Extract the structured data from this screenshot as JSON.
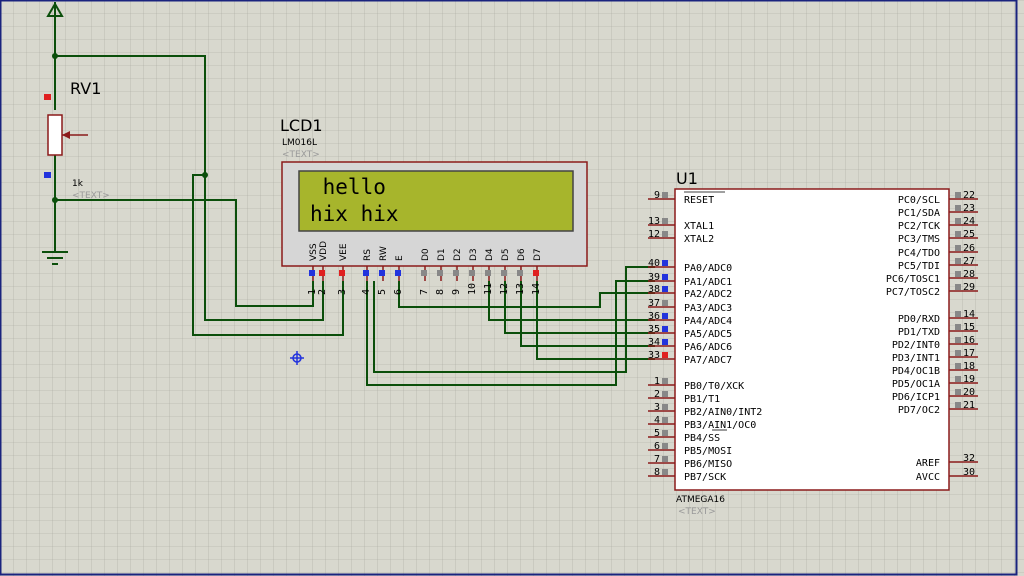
{
  "rv1": {
    "ref": "RV1",
    "value": "1k",
    "text": "<TEXT>"
  },
  "lcd": {
    "ref": "LCD1",
    "part": "LM016L",
    "text": "<TEXT>",
    "line1": " hello",
    "line2": "hix hix",
    "screen_color": "#a7b52c",
    "pins": [
      {
        "num": "1",
        "name": "VSS"
      },
      {
        "num": "2",
        "name": "VDD"
      },
      {
        "num": "3",
        "name": "VEE"
      },
      {
        "num": "4",
        "name": "RS"
      },
      {
        "num": "5",
        "name": "RW"
      },
      {
        "num": "6",
        "name": "E"
      },
      {
        "num": "7",
        "name": "D0"
      },
      {
        "num": "8",
        "name": "D1"
      },
      {
        "num": "9",
        "name": "D2"
      },
      {
        "num": "10",
        "name": "D3"
      },
      {
        "num": "11",
        "name": "D4"
      },
      {
        "num": "12",
        "name": "D5"
      },
      {
        "num": "13",
        "name": "D6"
      },
      {
        "num": "14",
        "name": "D7"
      }
    ]
  },
  "mcu": {
    "ref": "U1",
    "part": "ATMEGA16",
    "text": "<TEXT>",
    "left_pins": [
      {
        "num": "9",
        "name": "RESET"
      },
      {
        "num": "13",
        "name": "XTAL1"
      },
      {
        "num": "12",
        "name": "XTAL2"
      },
      {
        "num": "40",
        "name": "PA0/ADC0"
      },
      {
        "num": "39",
        "name": "PA1/ADC1"
      },
      {
        "num": "38",
        "name": "PA2/ADC2"
      },
      {
        "num": "37",
        "name": "PA3/ADC3"
      },
      {
        "num": "36",
        "name": "PA4/ADC4"
      },
      {
        "num": "35",
        "name": "PA5/ADC5"
      },
      {
        "num": "34",
        "name": "PA6/ADC6"
      },
      {
        "num": "33",
        "name": "PA7/ADC7"
      },
      {
        "num": "1",
        "name": "PB0/T0/XCK"
      },
      {
        "num": "2",
        "name": "PB1/T1"
      },
      {
        "num": "3",
        "name": "PB2/AIN0/INT2"
      },
      {
        "num": "4",
        "name": "PB3/AIN1/OC0"
      },
      {
        "num": "5",
        "name": "PB4/SS"
      },
      {
        "num": "6",
        "name": "PB5/MOSI"
      },
      {
        "num": "7",
        "name": "PB6/MISO"
      },
      {
        "num": "8",
        "name": "PB7/SCK"
      }
    ],
    "right_pins": [
      {
        "num": "22",
        "name": "PC0/SCL"
      },
      {
        "num": "23",
        "name": "PC1/SDA"
      },
      {
        "num": "24",
        "name": "PC2/TCK"
      },
      {
        "num": "25",
        "name": "PC3/TMS"
      },
      {
        "num": "26",
        "name": "PC4/TDO"
      },
      {
        "num": "27",
        "name": "PC5/TDI"
      },
      {
        "num": "28",
        "name": "PC6/TOSC1"
      },
      {
        "num": "29",
        "name": "PC7/TOSC2"
      },
      {
        "num": "14",
        "name": "PD0/RXD"
      },
      {
        "num": "15",
        "name": "PD1/TXD"
      },
      {
        "num": "16",
        "name": "PD2/INT0"
      },
      {
        "num": "17",
        "name": "PD3/INT1"
      },
      {
        "num": "18",
        "name": "PD4/OC1B"
      },
      {
        "num": "19",
        "name": "PD5/OC1A"
      },
      {
        "num": "20",
        "name": "PD6/ICP1"
      },
      {
        "num": "21",
        "name": "PD7/OC2"
      },
      {
        "num": "32",
        "name": "AREF"
      },
      {
        "num": "30",
        "name": "AVCC"
      }
    ]
  },
  "colors": {
    "wire": "#0b4f0b",
    "body_border": "#8b1a1a",
    "body_fill": "#ffffff",
    "pin_active": "#e02020",
    "pin_idle": "#2233dd",
    "pin_off": "#888888"
  }
}
